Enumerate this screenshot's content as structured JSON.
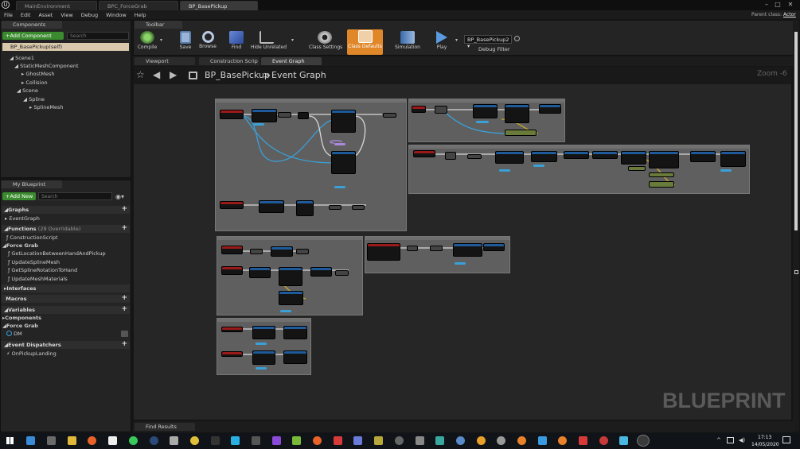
{
  "window": {
    "tabs": [
      "MainEnvironment",
      "BPC_ForceGrab",
      "BP_BasePickup"
    ],
    "parent_class_label": "Parent class:",
    "parent_class_value": "Actor"
  },
  "menu": [
    "File",
    "Edit",
    "Asset",
    "View",
    "Debug",
    "Window",
    "Help"
  ],
  "components": {
    "tab_label": "Components",
    "add_button": "+Add Component",
    "search_placeholder": "Search",
    "self_item": "BP_BasePickup(self)",
    "tree": [
      "Scene1",
      "StaticMeshComponent",
      "GhostMesh",
      "Collision",
      "Scene",
      "Spline",
      "SplineMesh"
    ]
  },
  "my_blueprint": {
    "tab_label": "My Blueprint",
    "add_button": "+Add New",
    "search_placeholder": "Search",
    "graphs_header": "Graphs",
    "graph_items": [
      "EventGraph"
    ],
    "functions_header": "Functions",
    "functions_count": "(29 Overridable)",
    "function_items": [
      "ConstructionScript"
    ],
    "force_grab_category": "Force Grab",
    "force_grab_functions": [
      "GetLocationBetweenHandAndPickup",
      "UpdateSplineMesh",
      "GetSplineRotationToHand",
      "UpdateMeshMaterials"
    ],
    "interfaces_header": "Interfaces",
    "macros_header": "Macros",
    "variables_header": "Variables",
    "components_category": "Components",
    "force_grab_var_category": "Force Grab",
    "variable_items": [
      "DM"
    ],
    "dispatchers_header": "Event Dispatchers",
    "dispatcher_items": [
      "OnPickupLanding"
    ]
  },
  "toolbar": {
    "tab_label": "Toolbar",
    "buttons": [
      "Compile",
      "Save",
      "Browse",
      "Find",
      "Hide Unrelated",
      "Class Settings",
      "Class Defaults",
      "Simulation",
      "Play"
    ],
    "debug_object": "BP_BasePickup2",
    "debug_filter_label": "Debug Filter"
  },
  "editor_tabs": [
    "Viewport",
    "Construction Scrip",
    "Event Graph"
  ],
  "breadcrumb": {
    "blueprint": "BP_BasePickup",
    "separator": ">",
    "graph": "Event Graph"
  },
  "graph": {
    "zoom": "Zoom -6",
    "watermark": "BLUEPRINT"
  },
  "find_results_tab": "Find Results",
  "taskbar": {
    "time": "17:13",
    "date": "14/05/2020"
  },
  "colors": {
    "accent_orange": "#e0872a",
    "add_green": "#3a8a2e",
    "exec_wire": "#d8d8d8",
    "object_wire": "#3aa0d8",
    "bool_wire": "#c8a82a",
    "event_red": "#9a1a1a",
    "function_blue": "#1f5b9a"
  }
}
